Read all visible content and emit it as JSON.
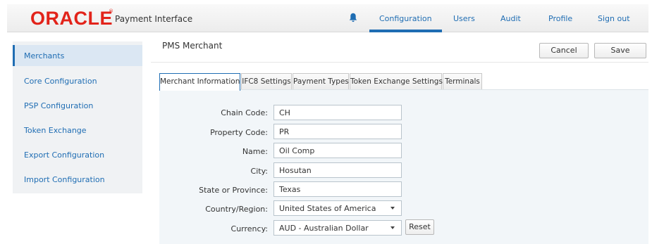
{
  "header": {
    "logo_text": "ORACLE",
    "logo_mark": "®",
    "app_name": "Payment Interface",
    "nav": [
      {
        "label": "Configuration"
      },
      {
        "label": "Users"
      },
      {
        "label": "Audit"
      },
      {
        "label": "Profile"
      },
      {
        "label": "Sign out"
      }
    ],
    "active_nav": "Configuration",
    "accent_color": "#1f6db3",
    "logo_color": "#e2231a",
    "bell_icon": "bell-icon"
  },
  "sidebar": {
    "items": [
      {
        "label": "Merchants"
      },
      {
        "label": "Core Configuration"
      },
      {
        "label": "PSP Configuration"
      },
      {
        "label": "Token Exchange"
      },
      {
        "label": "Export Configuration"
      },
      {
        "label": "Import Configuration"
      }
    ],
    "active": "Merchants"
  },
  "main": {
    "title": "PMS Merchant",
    "cancel_label": "Cancel",
    "save_label": "Save",
    "tabs": [
      {
        "label": "Merchant Information"
      },
      {
        "label": "IFC8 Settings"
      },
      {
        "label": "Payment Types"
      },
      {
        "label": "Token Exchange Settings"
      },
      {
        "label": "Terminals"
      }
    ],
    "active_tab": "Merchant Information"
  },
  "form": {
    "chain_code": {
      "label": "Chain Code:",
      "value": "CH"
    },
    "property_code": {
      "label": "Property Code:",
      "value": "PR"
    },
    "name": {
      "label": "Name:",
      "value": "Oil Comp"
    },
    "city": {
      "label": "City:",
      "value": "Hosutan"
    },
    "state": {
      "label": "State or Province:",
      "value": "Texas"
    },
    "country": {
      "label": "Country/Region:",
      "value": "United States of America"
    },
    "currency": {
      "label": "Currency:",
      "value": "AUD - Australian Dollar"
    },
    "reset_label": "Reset"
  }
}
